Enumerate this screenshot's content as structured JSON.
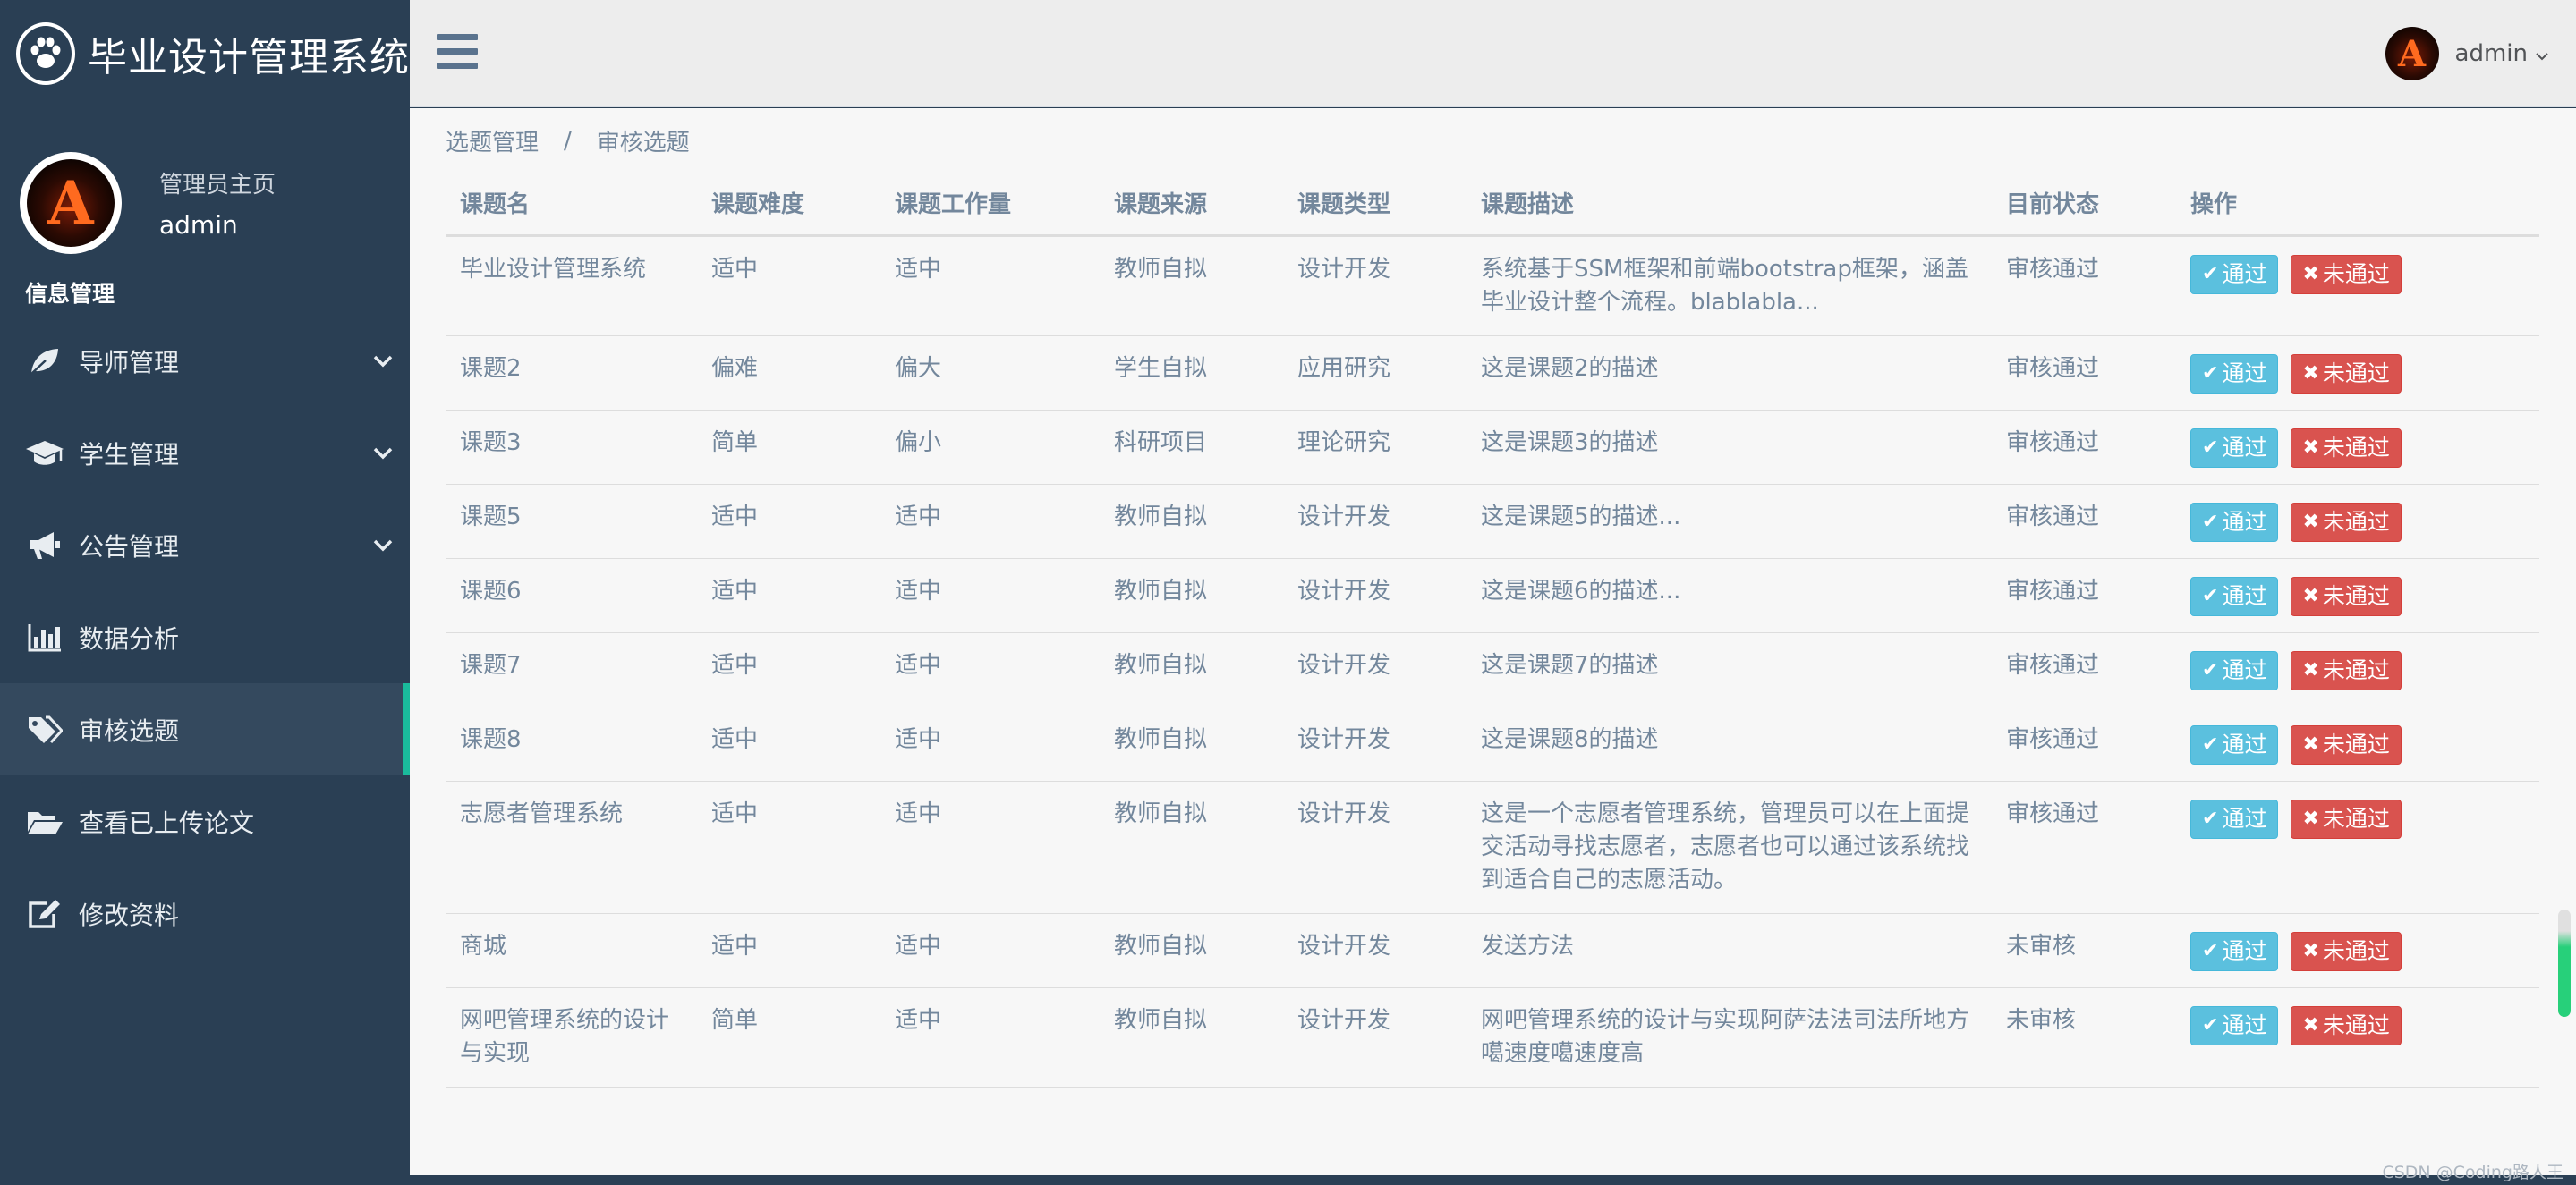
{
  "brand": {
    "title": "毕业设计管理系统",
    "icon": "paw-icon"
  },
  "profile": {
    "welcome": "管理员主页",
    "name": "admin",
    "avatar_letter": "A"
  },
  "sidebar": {
    "section_title": "信息管理",
    "items": [
      {
        "label": "导师管理",
        "icon": "leaf-icon",
        "has_submenu": true
      },
      {
        "label": "学生管理",
        "icon": "graduation-cap-icon",
        "has_submenu": true
      },
      {
        "label": "公告管理",
        "icon": "bullhorn-icon",
        "has_submenu": true
      },
      {
        "label": "数据分析",
        "icon": "bar-chart-icon",
        "has_submenu": false
      },
      {
        "label": "审核选题",
        "icon": "tags-icon",
        "has_submenu": false,
        "active": true
      },
      {
        "label": "查看已上传论文",
        "icon": "folder-open-icon",
        "has_submenu": false
      },
      {
        "label": "修改资料",
        "icon": "edit-icon",
        "has_submenu": false
      }
    ]
  },
  "topbar": {
    "user_name": "admin",
    "avatar_letter": "A"
  },
  "breadcrumb": {
    "parent": "选题管理",
    "separator": "/",
    "current": "审核选题"
  },
  "table": {
    "headers": [
      "课题名",
      "课题难度",
      "课题工作量",
      "课题来源",
      "课题类型",
      "课题描述",
      "目前状态",
      "操作"
    ],
    "rows": [
      [
        "毕业设计管理系统",
        "适中",
        "适中",
        "教师自拟",
        "设计开发",
        "系统基于SSM框架和前端bootstrap框架，涵盖毕业设计整个流程。blablabla...",
        "审核通过"
      ],
      [
        "课题2",
        "偏难",
        "偏大",
        "学生自拟",
        "应用研究",
        "这是课题2的描述",
        "审核通过"
      ],
      [
        "课题3",
        "简单",
        "偏小",
        "科研项目",
        "理论研究",
        "这是课题3的描述",
        "审核通过"
      ],
      [
        "课题5",
        "适中",
        "适中",
        "教师自拟",
        "设计开发",
        "这是课题5的描述...",
        "审核通过"
      ],
      [
        "课题6",
        "适中",
        "适中",
        "教师自拟",
        "设计开发",
        "这是课题6的描述...",
        "审核通过"
      ],
      [
        "课题7",
        "适中",
        "适中",
        "教师自拟",
        "设计开发",
        "这是课题7的描述",
        "审核通过"
      ],
      [
        "课题8",
        "适中",
        "适中",
        "教师自拟",
        "设计开发",
        "这是课题8的描述",
        "审核通过"
      ],
      [
        "志愿者管理系统",
        "适中",
        "适中",
        "教师自拟",
        "设计开发",
        "这是一个志愿者管理系统，管理员可以在上面提交活动寻找志愿者，志愿者也可以通过该系统找到适合自己的志愿活动。",
        "审核通过"
      ],
      [
        "商城",
        "适中",
        "适中",
        "教师自拟",
        "设计开发",
        "发送方法",
        "未审核"
      ],
      [
        "网吧管理系统的设计与实现",
        "简单",
        "适中",
        "教师自拟",
        "设计开发",
        "网吧管理系统的设计与实现阿萨法法司法所地方噶速度噶速度高",
        "未审核"
      ]
    ],
    "pass_label": "通过",
    "fail_label": "未通过"
  },
  "watermark": "CSDN @Coding路人王",
  "colors": {
    "sidebar": "#2a3f54",
    "active_accent": "#1abb9c",
    "pass": "#5bc0de",
    "fail": "#d9534f",
    "text": "#73879c"
  }
}
